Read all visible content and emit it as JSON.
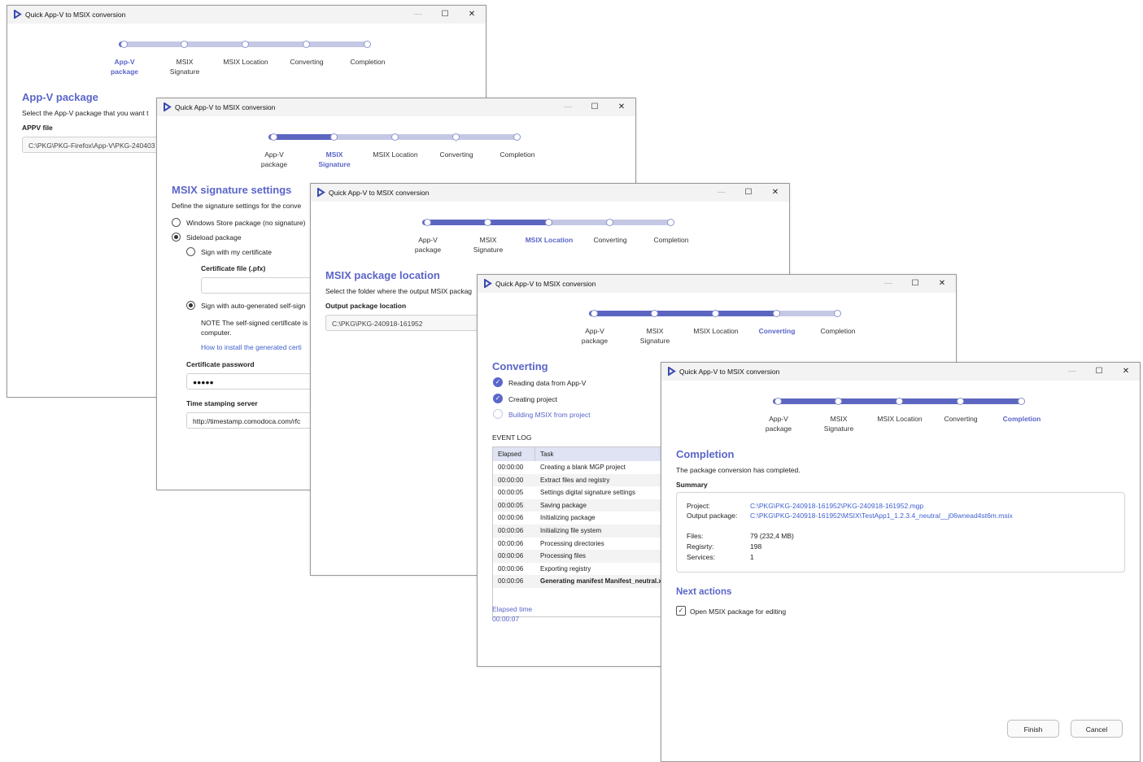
{
  "window_title": "Quick App-V to MSIX conversion",
  "window_controls": {
    "minimize": "—",
    "maximize": "☐",
    "close": "✕"
  },
  "steps": [
    {
      "line1": "App-V",
      "line2": "package"
    },
    {
      "line1": "MSIX",
      "line2": "Signature"
    },
    {
      "line1": "MSIX Location",
      "line2": ""
    },
    {
      "line1": "Converting",
      "line2": ""
    },
    {
      "line1": "Completion",
      "line2": ""
    }
  ],
  "w1": {
    "heading": "App-V package",
    "description": "Select the App-V package that you want t",
    "appv_label": "APPV file",
    "appv_value": "C:\\PKG\\PKG-Firefox\\App-V\\PKG-240403"
  },
  "w2": {
    "heading": "MSIX signature settings",
    "description": "Define the signature settings for the conve",
    "store_option": "Windows Store package (no signature)",
    "sideload_option": "Sideload package",
    "sign_my_cert": "Sign with my certificate",
    "cert_file_label": "Certificate file (.pfx)",
    "sign_auto": "Sign with auto-generated self-sign",
    "note_line1": "NOTE The self-signed certificate is",
    "note_line2": "computer.",
    "how_to_link": "How to install the generated certi",
    "password_label": "Certificate password",
    "password_value": "●●●●●",
    "timestamp_label": "Time stamping server",
    "timestamp_value": "http://timestamp.comodoca.com/rfc"
  },
  "w3": {
    "heading": "MSIX package location",
    "description": "Select the folder where the output MSIX packag",
    "output_label": "Output package location",
    "output_value": "C:\\PKG\\PKG-240918-161952"
  },
  "w4": {
    "heading": "Converting",
    "tasks": [
      {
        "label": "Reading data from App-V",
        "done": true
      },
      {
        "label": "Creating project",
        "done": true
      },
      {
        "label": "Building MSIX from project",
        "done": false
      }
    ],
    "event_log_label": "EVENT LOG",
    "col_elapsed": "Elapsed",
    "col_task": "Task",
    "log": [
      {
        "elapsed": "00:00:00",
        "task": "Creating a blank MGP project"
      },
      {
        "elapsed": "00:00:00",
        "task": "Extract files and registry"
      },
      {
        "elapsed": "00:00:05",
        "task": "Settings digital signature settings"
      },
      {
        "elapsed": "00:00:05",
        "task": "Saving package"
      },
      {
        "elapsed": "00:00:06",
        "task": "Initializing package"
      },
      {
        "elapsed": "00:00:06",
        "task": "Initializing file system"
      },
      {
        "elapsed": "00:00:06",
        "task": "Processing directories"
      },
      {
        "elapsed": "00:00:06",
        "task": "Processing files"
      },
      {
        "elapsed": "00:00:06",
        "task": "Exporting registry"
      },
      {
        "elapsed": "00:00:06",
        "task": "Generating manifest Manifest_neutral.xi"
      }
    ],
    "elapsed_label": "Elapsed time",
    "elapsed_value": "00:00:07"
  },
  "w5": {
    "heading": "Completion",
    "description": "The package conversion has completed.",
    "summary_label": "Summary",
    "project_label": "Project:",
    "project_value": "C:\\PKG\\PKG-240918-161952\\PKG-240918-161952.mgp",
    "output_label": "Output package:",
    "output_value": "C:\\PKG\\PKG-240918-161952\\MSIX\\TestApp1_1.2.3.4_neutral__j06wnead4st6m.msix",
    "files_label": "Files:",
    "files_value": "79 (232,4 MB)",
    "registry_label": "Regisrty:",
    "registry_value": "198",
    "services_label": "Services:",
    "services_value": "1",
    "next_actions": "Next actions",
    "open_msix": "Open MSIX package for editing",
    "finish": "Finish",
    "cancel": "Cancel"
  },
  "colors": {
    "accent": "#5b65c9",
    "track": "#c5c8e4",
    "fill": "#5c66c0",
    "link": "#3f5fd0"
  }
}
